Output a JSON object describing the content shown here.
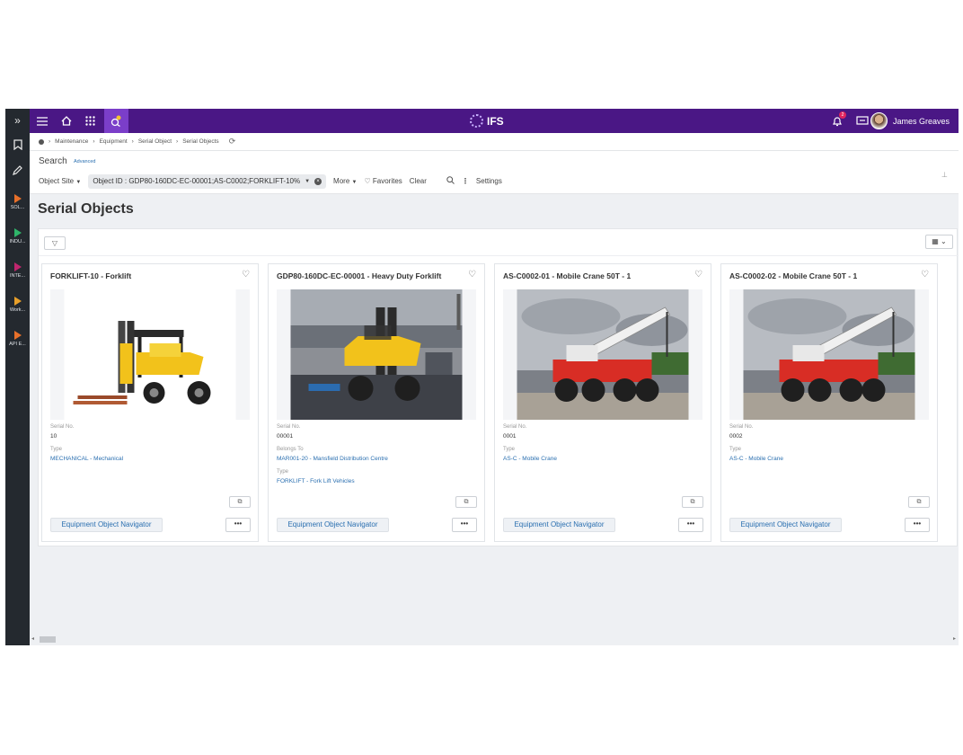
{
  "topbar": {
    "logo_text": "IFS",
    "notification_count": "2",
    "user_name": "James Greaves"
  },
  "rail": {
    "items": [
      "SOL...",
      "INDU...",
      "INTE...",
      "Work...",
      "API E..."
    ],
    "colors": [
      "#e8702a",
      "#2fb56a",
      "#c0266e",
      "#e8a02a",
      "#e8702a"
    ]
  },
  "breadcrumb": [
    "Maintenance",
    "Equipment",
    "Serial Object",
    "Serial Objects"
  ],
  "search": {
    "title": "Search",
    "advanced": "Advanced",
    "object_site": "Object Site",
    "object_id_chip": "Object ID : GDP80-160DC-EC-00001;AS-C0002;FORKLIFT-10%",
    "more": "More",
    "favorites": "Favorites",
    "clear": "Clear",
    "settings": "Settings"
  },
  "page": {
    "title": "Serial Objects"
  },
  "cards": [
    {
      "title": "FORKLIFT-10 - Forklift",
      "image": "forklift-yellow",
      "serial_label": "Serial No.",
      "serial_value": "10",
      "belongs_label": "",
      "belongs_value": "",
      "type_label": "Type",
      "type_value": "MECHANICAL - Mechanical",
      "nav_label": "Equipment Object Navigator",
      "more_label": "•••"
    },
    {
      "title": "GDP80-160DC-EC-00001 - Heavy Duty Forklift",
      "image": "heavy-forklift-yard",
      "serial_label": "Serial No.",
      "serial_value": "00001",
      "belongs_label": "Belongs To",
      "belongs_value": "MAR001-20 - Mansfield Distribution Centre",
      "type_label": "Type",
      "type_value": "FORKLIFT - Fork Lift Vehicles",
      "nav_label": "Equipment Object Navigator",
      "more_label": "•••"
    },
    {
      "title": "AS-C0002-01 - Mobile Crane 50T - 1",
      "image": "mobile-crane",
      "serial_label": "Serial No.",
      "serial_value": "0001",
      "belongs_label": "",
      "belongs_value": "",
      "type_label": "Type",
      "type_value": "AS-C - Mobile Crane",
      "nav_label": "Equipment Object Navigator",
      "more_label": "•••"
    },
    {
      "title": "AS-C0002-02 - Mobile Crane 50T - 1",
      "image": "mobile-crane",
      "serial_label": "Serial No.",
      "serial_value": "0002",
      "belongs_label": "",
      "belongs_value": "",
      "type_label": "Type",
      "type_value": "AS-C - Mobile Crane",
      "nav_label": "Equipment Object Navigator",
      "more_label": "•••"
    }
  ],
  "colors": {
    "topbar": "#4a1785",
    "rail": "#24292f",
    "link": "#2a6fb0",
    "search_active": "#7b3ec9"
  }
}
